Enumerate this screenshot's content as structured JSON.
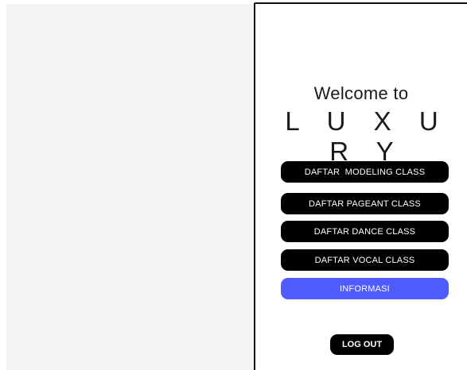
{
  "welcome": {
    "greeting": "Welcome to",
    "brand": "L U X U R Y"
  },
  "menu": {
    "modeling_label": "DAFTAR  MODELING CLASS",
    "pageant_label": "DAFTAR PAGEANT CLASS",
    "dance_label": "DAFTAR DANCE CLASS",
    "vocal_label": "DAFTAR VOCAL CLASS",
    "info_label": "INFORMASI"
  },
  "footer": {
    "logout_label": "LOG OUT"
  },
  "colors": {
    "button_black": "#000000",
    "info_accent": "#4f5bfd",
    "left_panel_bg": "#f4f4f4"
  }
}
